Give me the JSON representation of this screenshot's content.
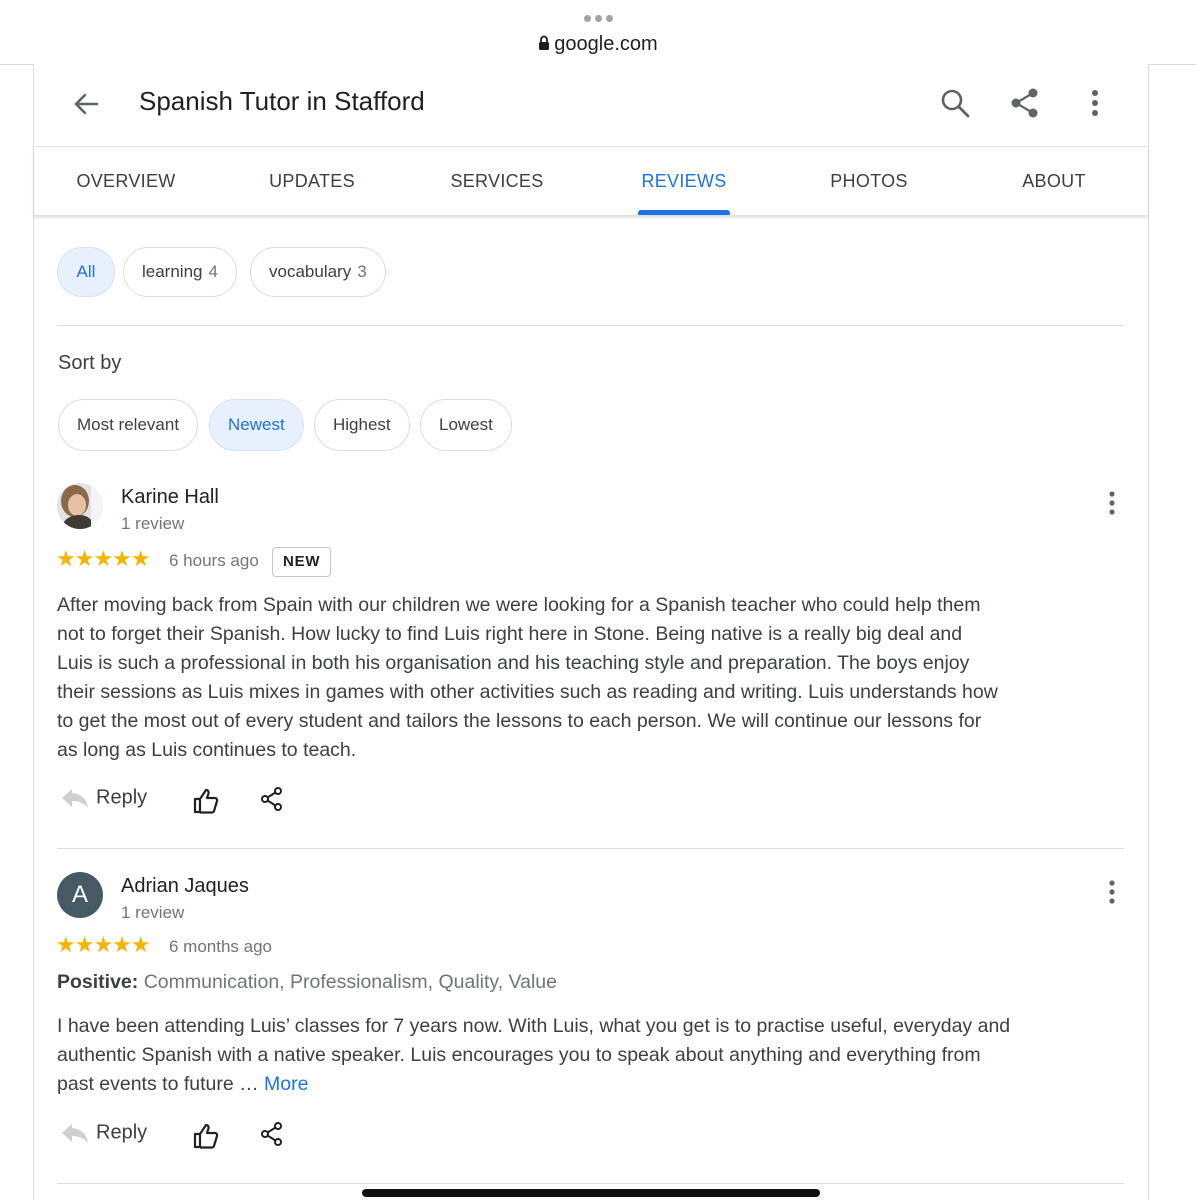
{
  "browser": {
    "url": "google.com"
  },
  "header": {
    "title": "Spanish Tutor in Stafford"
  },
  "tabs": [
    {
      "label": "OVERVIEW"
    },
    {
      "label": "UPDATES"
    },
    {
      "label": "SERVICES"
    },
    {
      "label": "REVIEWS"
    },
    {
      "label": "PHOTOS"
    },
    {
      "label": "ABOUT"
    }
  ],
  "active_tab": "REVIEWS",
  "topics": [
    {
      "label": "All",
      "count": ""
    },
    {
      "label": "learning",
      "count": "4"
    },
    {
      "label": "vocabulary",
      "count": "3"
    }
  ],
  "sort": {
    "label": "Sort by",
    "options": [
      "Most relevant",
      "Newest",
      "Highest",
      "Lowest"
    ],
    "selected": "Newest"
  },
  "reviews": [
    {
      "name": "Karine Hall",
      "meta": "1 review",
      "stars": "★★★★★",
      "rating": 5,
      "time": "6 hours ago",
      "badge": "NEW",
      "text": "After moving back from Spain with our children we were looking for a Spanish teacher who could help them not to forget their Spanish. How lucky to find Luis right here in Stone. Being native is a really big deal and Luis is such a professional in both his organisation and his teaching style and preparation. The boys enjoy their sessions as Luis mixes in games with other activities such as reading and writing. Luis understands how to get the most out of every student and tailors the lessons to each person. We will continue our lessons for as long as Luis continues to teach.",
      "reply_label": "Reply"
    },
    {
      "name": "Adrian Jaques",
      "avatar_letter": "A",
      "meta": "1 review",
      "stars": "★★★★★",
      "rating": 5,
      "time": "6 months ago",
      "positive_label": "Positive:",
      "positive_values": "Communication, Professionalism, Quality, Value",
      "text": "I have been attending Luis’ classes for 7 years now. With Luis, what you get is to practise useful, everyday and authentic Spanish with a native speaker. Luis encourages you to speak about anything and everything from past events to future …",
      "more_label": "More",
      "reply_label": "Reply"
    }
  ],
  "colors": {
    "accent": "#1a73e8",
    "star": "#f4b400",
    "chip_selected_bg": "#e8f0fe",
    "avatar_bg": "#455a64"
  }
}
